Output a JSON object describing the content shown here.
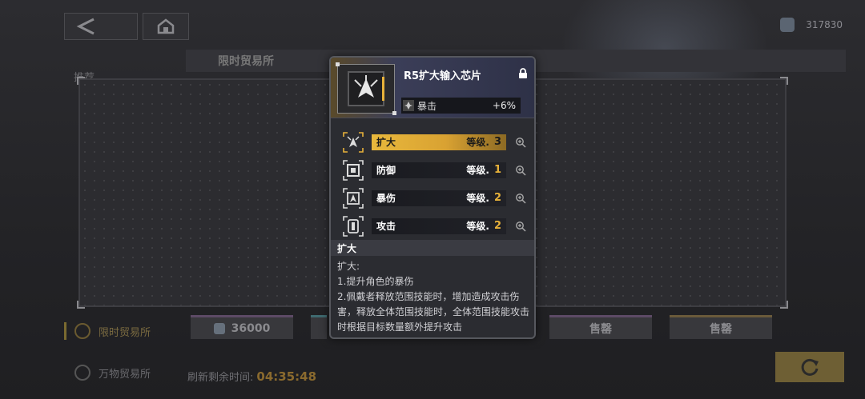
{
  "header": {
    "currency_value": "317830",
    "section_title": "限时贸易所"
  },
  "sidebar": {
    "items": [
      {
        "label": "推荐"
      },
      {
        "label": "限时贸易所"
      },
      {
        "label": "万物贸易所"
      }
    ]
  },
  "shop": {
    "prices": [
      {
        "label": "36000"
      },
      {
        "label": "售罄"
      },
      {
        "label": "售罄"
      }
    ],
    "refresh_label": "刷新剩余时间:",
    "refresh_time": "04:35:48"
  },
  "popup": {
    "chip_name": "R5扩大输入芯片",
    "main_stat": {
      "name": "暴击",
      "value": "+6%"
    },
    "skills": [
      {
        "name": "扩大",
        "level_label": "等级.",
        "level": "3",
        "icon": "expand-icon",
        "active": true
      },
      {
        "name": "防御",
        "level_label": "等级.",
        "level": "1",
        "icon": "defense-icon",
        "active": false
      },
      {
        "name": "暴伤",
        "level_label": "等级.",
        "level": "2",
        "icon": "crit-damage-icon",
        "active": false
      },
      {
        "name": "攻击",
        "level_label": "等级.",
        "level": "2",
        "icon": "attack-icon",
        "active": false
      }
    ],
    "description_title": "扩大",
    "description_lines": [
      "扩大:",
      "1.提升角色的暴伤",
      "2.佩戴者释放范围技能时，增加造成攻击伤害，释放全体范围技能时，全体范围技能攻击时根据目标数量额外提升攻击"
    ]
  },
  "colors": {
    "accent_gold": "#e8b23a",
    "panel_bg": "#2b2c31"
  }
}
